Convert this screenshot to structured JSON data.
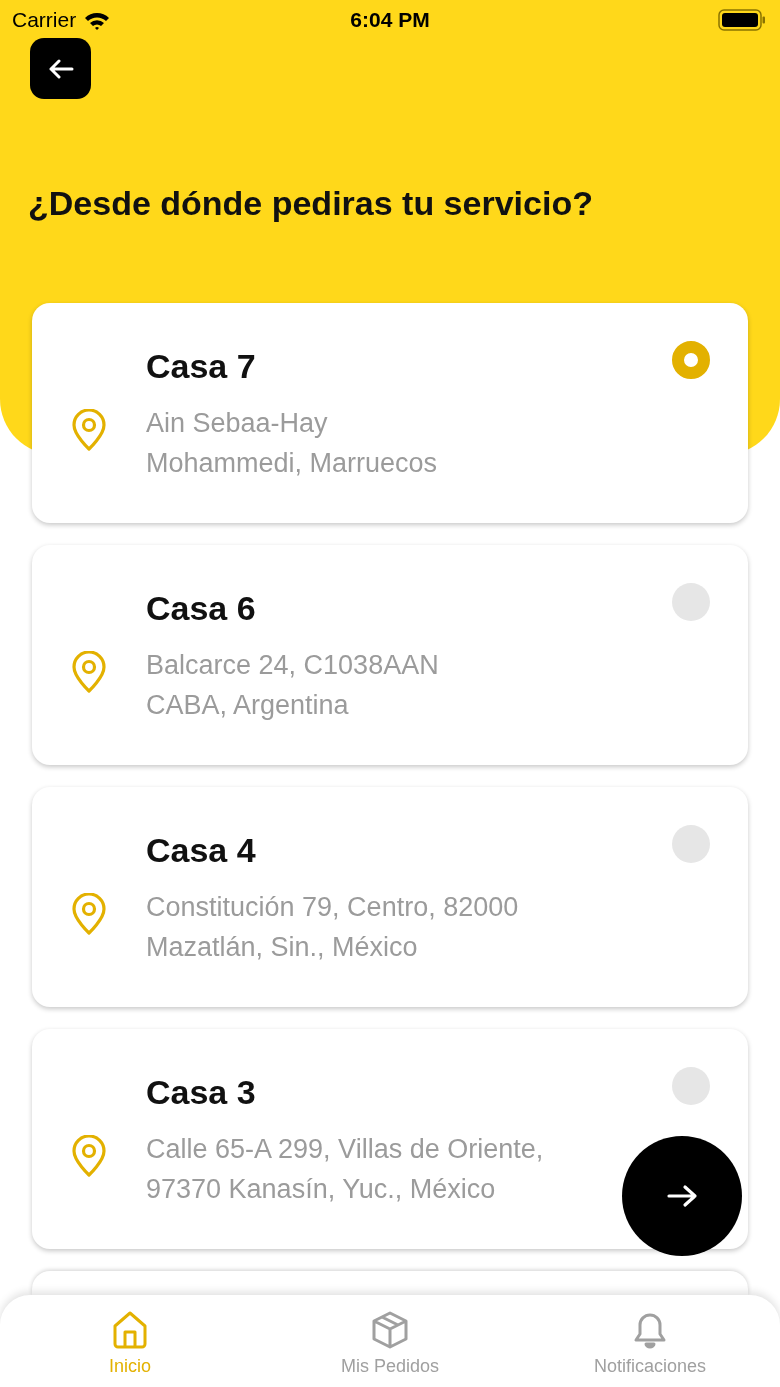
{
  "status_bar": {
    "carrier": "Carrier",
    "time": "6:04 PM"
  },
  "title": "¿Desde dónde pediras tu servicio?",
  "addresses": [
    {
      "name": "Casa 7",
      "lines": [
        "Ain Sebaa-Hay",
        "Mohammedi, Marruecos"
      ],
      "selected": true
    },
    {
      "name": "Casa 6",
      "lines": [
        "Balcarce 24, C1038AAN",
        "CABA, Argentina"
      ],
      "selected": false
    },
    {
      "name": "Casa 4",
      "lines": [
        "Constitución 79, Centro, 82000",
        "Mazatlán, Sin., México"
      ],
      "selected": false
    },
    {
      "name": "Casa 3",
      "lines": [
        "Calle 65-A 299, Villas de Oriente,",
        "97370 Kanasín, Yuc., México"
      ],
      "selected": false
    }
  ],
  "tabs": [
    {
      "kind": "home",
      "label": "Inicio",
      "selected": true
    },
    {
      "kind": "orders",
      "label": "Mis Pedidos",
      "selected": false
    },
    {
      "kind": "notifications",
      "label": "Notificaciones",
      "selected": false
    }
  ]
}
